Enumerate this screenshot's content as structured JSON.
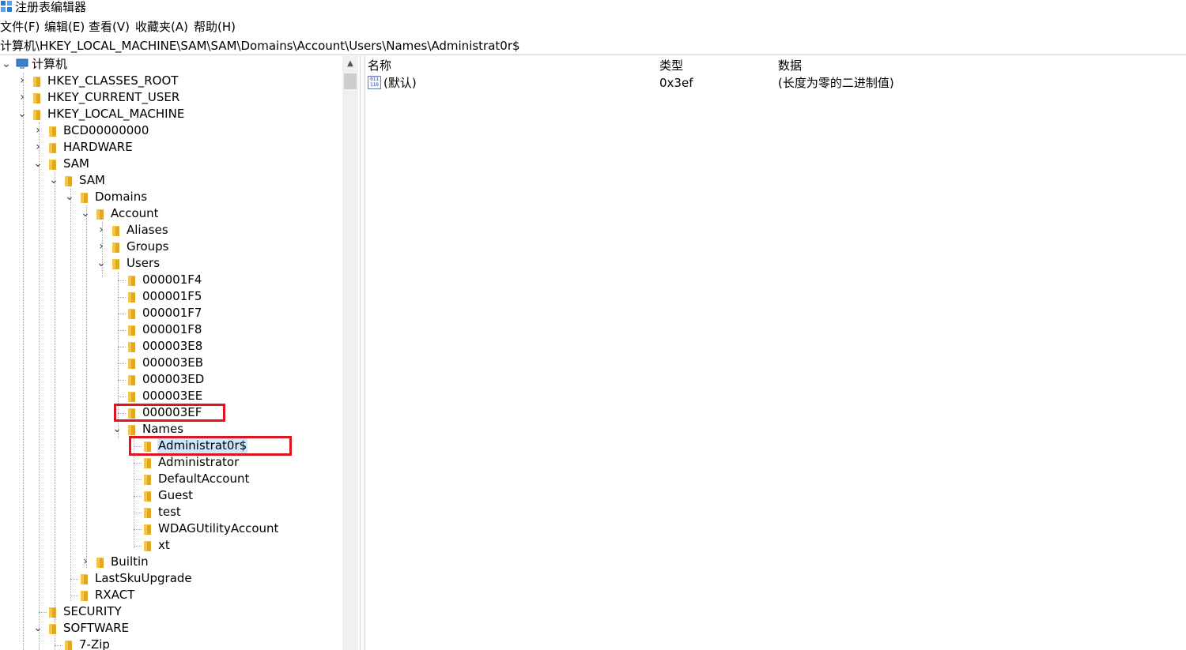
{
  "window": {
    "title": "注册表编辑器"
  },
  "menu": [
    "文件(F)",
    "编辑(E)",
    "查看(V)",
    "收藏夹(A)",
    "帮助(H)"
  ],
  "address": "计算机\\HKEY_LOCAL_MACHINE\\SAM\\SAM\\Domains\\Account\\Users\\Names\\Administrat0r$",
  "tree": {
    "root": "计算机",
    "hkcr": "HKEY_CLASSES_ROOT",
    "hkcu": "HKEY_CURRENT_USER",
    "hklm": "HKEY_LOCAL_MACHINE",
    "bcd": "BCD00000000",
    "hardware": "HARDWARE",
    "sam": "SAM",
    "sam_inner": "SAM",
    "domains": "Domains",
    "account": "Account",
    "aliases": "Aliases",
    "groups": "Groups",
    "users": "Users",
    "user_rids": [
      "000001F4",
      "000001F5",
      "000001F7",
      "000001F8",
      "000003E8",
      "000003EB",
      "000003ED",
      "000003EE",
      "000003EF"
    ],
    "names": "Names",
    "name_items": [
      "Administrat0r$",
      "Administrator",
      "DefaultAccount",
      "Guest",
      "test",
      "WDAGUtilityAccount",
      "xt"
    ],
    "builtin": "Builtin",
    "lastsku": "LastSkuUpgrade",
    "rxact": "RXACT",
    "security": "SECURITY",
    "software": "SOFTWARE",
    "sevenzip": "7-Zip"
  },
  "columns": {
    "name": "名称",
    "type": "类型",
    "data": "数据"
  },
  "values": [
    {
      "name": "(默认)",
      "type": "0x3ef",
      "data": "(长度为零的二进制值)",
      "icon": "binary-value-icon"
    }
  ],
  "colors": {
    "highlight_box": "#e0141e",
    "selection": "#cce8ff",
    "folder": "#f3c54a"
  }
}
